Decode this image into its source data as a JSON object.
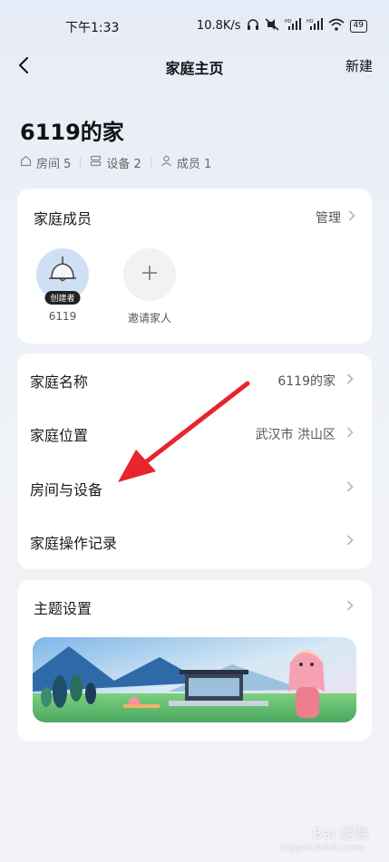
{
  "status_bar": {
    "time": "下午1:33",
    "network_speed": "10.8K/s",
    "battery": "49",
    "icons": [
      "headphones-icon",
      "mute-icon",
      "hd-signal-icon",
      "hd-signal-icon",
      "wifi-icon"
    ]
  },
  "nav": {
    "title": "家庭主页",
    "action": "新建",
    "back_icon": "chevron-left-icon"
  },
  "home": {
    "name": "6119的家",
    "stats": {
      "rooms": "房间 5",
      "devices": "设备 2",
      "members": "成员 1"
    }
  },
  "members_card": {
    "title": "家庭成员",
    "action": "管理",
    "members": [
      {
        "name": "6119",
        "badge": "创建者",
        "avatar": "lamp-avatar-icon"
      }
    ],
    "invite_label": "邀请家人"
  },
  "settings": {
    "rows": [
      {
        "label": "家庭名称",
        "value": "6119的家"
      },
      {
        "label": "家庭位置",
        "value": "武汉市 洪山区"
      },
      {
        "label": "房间与设备",
        "value": ""
      },
      {
        "label": "家庭操作记录",
        "value": ""
      }
    ]
  },
  "theme": {
    "title": "主题设置"
  },
  "watermark": {
    "brand": "Bai 经验",
    "url": "jingyan.baidu.com"
  },
  "colors": {
    "arrow": "#e8242c",
    "creator_avatar_bg": "#cfe0f5",
    "card_bg": "#ffffff"
  }
}
